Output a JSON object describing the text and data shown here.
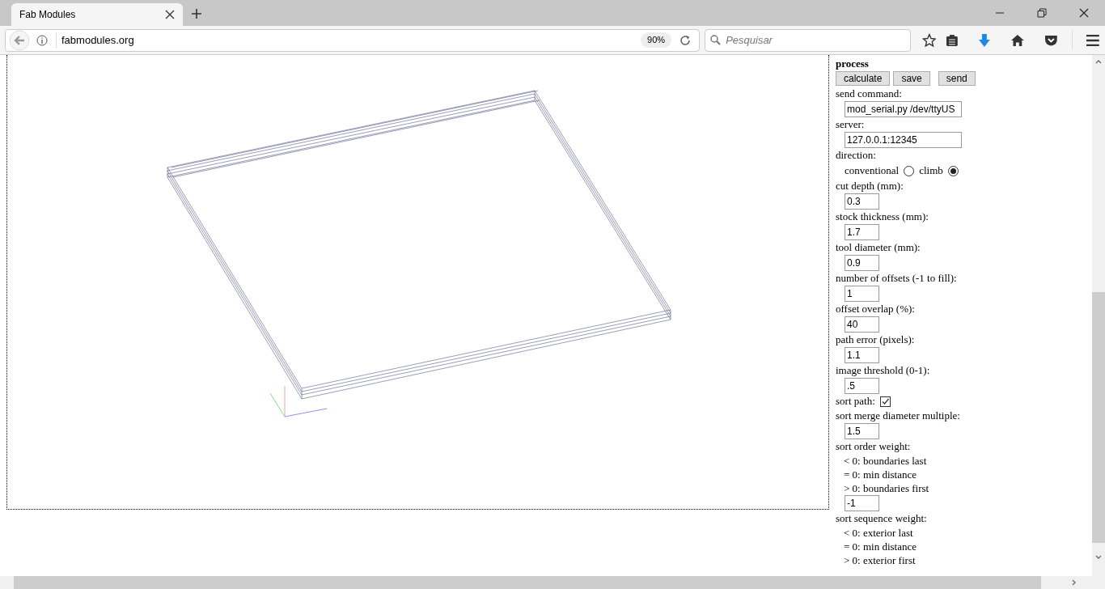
{
  "browser": {
    "tab_title": "Fab Modules",
    "url": "fabmodules.org",
    "zoom": "90%",
    "search_placeholder": "Pesquisar"
  },
  "panel": {
    "title": "process",
    "buttons": [
      "calculate",
      "save",
      "send"
    ],
    "fields": [
      {
        "kind": "wide_input",
        "label": "send command:",
        "value": "mod_serial.py /dev/ttyUS"
      },
      {
        "kind": "wide_input",
        "label": "server:",
        "value": "127.0.0.1:12345"
      },
      {
        "kind": "radio",
        "label": "direction:",
        "options": [
          {
            "label": "conventional",
            "selected": false
          },
          {
            "label": "climb",
            "selected": true
          }
        ]
      },
      {
        "kind": "input",
        "label": "cut depth (mm):",
        "value": "0.3"
      },
      {
        "kind": "input",
        "label": "stock thickness (mm):",
        "value": "1.7"
      },
      {
        "kind": "input",
        "label": "tool diameter (mm):",
        "value": "0.9"
      },
      {
        "kind": "input",
        "label": "number of offsets (-1 to fill):",
        "value": "1"
      },
      {
        "kind": "input",
        "label": "offset overlap (%):",
        "value": "40"
      },
      {
        "kind": "input",
        "label": "path error (pixels):",
        "value": "1.1"
      },
      {
        "kind": "input",
        "label": "image threshold (0-1):",
        "value": ".5"
      },
      {
        "kind": "checkbox",
        "label": "sort path:",
        "checked": true
      },
      {
        "kind": "input",
        "label": "sort merge diameter multiple:",
        "value": "1.5"
      },
      {
        "kind": "notes",
        "label": "sort order weight:",
        "notes": [
          "< 0: boundaries last",
          "= 0: min distance",
          "> 0: boundaries first"
        ]
      },
      {
        "kind": "bare_input",
        "value": "-1"
      },
      {
        "kind": "notes",
        "label": "sort sequence weight:",
        "notes": [
          "< 0: exterior last",
          "= 0: min distance",
          "> 0: exterior first"
        ]
      }
    ]
  }
}
